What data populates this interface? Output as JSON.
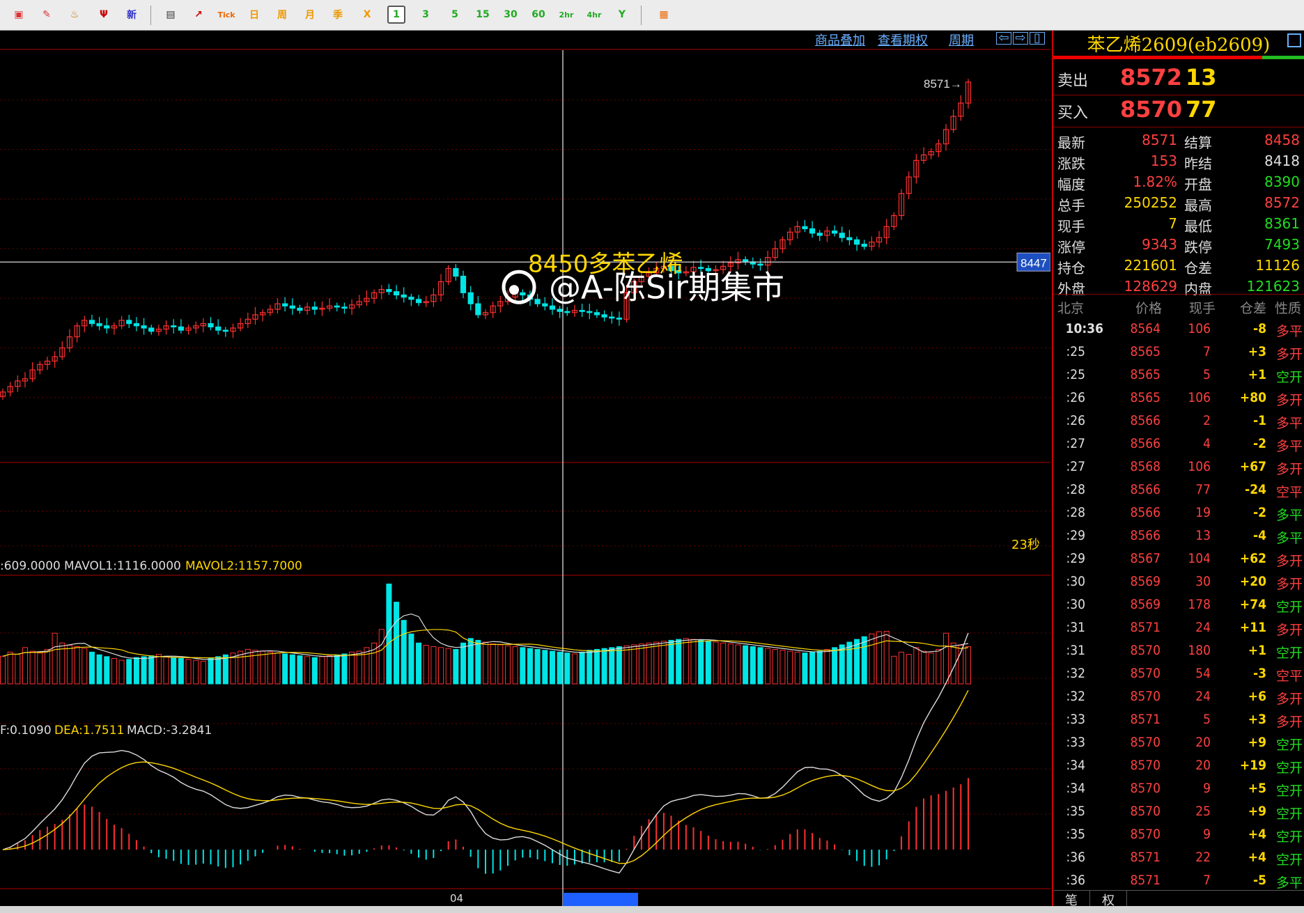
{
  "toolbar": {
    "buttons": [
      {
        "name": "window-icon",
        "glyph": "▣",
        "color": "#d33"
      },
      {
        "name": "pencil-icon",
        "glyph": "✎",
        "color": "#d33"
      },
      {
        "name": "bell-icon",
        "glyph": "♨",
        "color": "#c60"
      },
      {
        "name": "filter-icon",
        "glyph": "Ψ",
        "color": "#c00"
      },
      {
        "name": "new-icon",
        "glyph": "新",
        "color": "#33c"
      },
      {
        "name": "table-icon",
        "glyph": "▤",
        "color": "#333"
      },
      {
        "name": "chart-icon",
        "glyph": "↗",
        "color": "#c00"
      },
      {
        "name": "tick-button",
        "glyph": "Tick",
        "color": "#e60"
      },
      {
        "name": "day-button",
        "glyph": "日",
        "color": "#e90"
      },
      {
        "name": "week-button",
        "glyph": "周",
        "color": "#e90"
      },
      {
        "name": "month-button",
        "glyph": "月",
        "color": "#e90"
      },
      {
        "name": "season-button",
        "glyph": "季",
        "color": "#e90"
      },
      {
        "name": "year-button",
        "glyph": "X",
        "color": "#e90"
      },
      {
        "name": "1min-button",
        "glyph": "1",
        "color": "#2a2"
      },
      {
        "name": "3min-button",
        "glyph": "3",
        "color": "#2a2"
      },
      {
        "name": "5min-button",
        "glyph": "5",
        "color": "#2a2"
      },
      {
        "name": "15min-button",
        "glyph": "15",
        "color": "#2a2"
      },
      {
        "name": "30min-button",
        "glyph": "30",
        "color": "#2a2"
      },
      {
        "name": "60min-button",
        "glyph": "60",
        "color": "#2a2"
      },
      {
        "name": "2h-button",
        "glyph": "2hr",
        "color": "#2a2"
      },
      {
        "name": "4h-button",
        "glyph": "4hr",
        "color": "#2a2"
      },
      {
        "name": "y-button",
        "glyph": "Y",
        "color": "#2a2"
      },
      {
        "name": "calculator-icon",
        "glyph": "▦",
        "color": "#e60"
      }
    ]
  },
  "chart_links": {
    "overlay": "商品叠加",
    "options": "查看期权",
    "period": "周期"
  },
  "main_chart": {
    "last_price_label": "8571",
    "crosshair_price": "8447",
    "countdown": "23秒",
    "annotation": "8450多苯乙烯",
    "watermark": "@A-陈Sir期集市",
    "x_tick": "04"
  },
  "volume_panel": {
    "vol_label": ":609.0000",
    "mavol1": "MAVOL1:1116.0000",
    "mavol2": "MAVOL2:1157.7000"
  },
  "macd_panel": {
    "dif": "F:0.1090",
    "dea": "DEA:1.7511",
    "macd": "MACD:-3.2841"
  },
  "sidebar": {
    "title": "苯乙烯2609(eb2609)",
    "sell": {
      "label": "卖出",
      "price": "8572",
      "volume": "13"
    },
    "buy": {
      "label": "买入",
      "price": "8570",
      "volume": "77"
    },
    "quotes": [
      {
        "l1": "最新",
        "v1": "8571",
        "c1": "#ff4040",
        "l2": "结算",
        "v2": "8458",
        "c2": "#ff4040"
      },
      {
        "l1": "涨跌",
        "v1": "153",
        "c1": "#ff4040",
        "l2": "昨结",
        "v2": "8418",
        "c2": "#e0e0e0"
      },
      {
        "l1": "幅度",
        "v1": "1.82%",
        "c1": "#ff4040",
        "l2": "开盘",
        "v2": "8390",
        "c2": "#22dd22"
      },
      {
        "l1": "总手",
        "v1": "250252",
        "c1": "#ffd700",
        "l2": "最高",
        "v2": "8572",
        "c2": "#ff4040"
      },
      {
        "l1": "现手",
        "v1": "7",
        "c1": "#ffd700",
        "l2": "最低",
        "v2": "8361",
        "c2": "#22dd22"
      },
      {
        "l1": "涨停",
        "v1": "9343",
        "c1": "#ff4040",
        "l2": "跌停",
        "v2": "7493",
        "c2": "#22dd22"
      },
      {
        "l1": "持仓",
        "v1": "221601",
        "c1": "#ffd700",
        "l2": "仓差",
        "v2": "11126",
        "c2": "#ffd700"
      },
      {
        "l1": "外盘",
        "v1": "128629",
        "c1": "#ff4040",
        "l2": "内盘",
        "v2": "121623",
        "c2": "#22dd22"
      }
    ],
    "tick_headers": {
      "time": "北京",
      "price": "价格",
      "vol": "现手",
      "oi": "仓差",
      "nature": "性质"
    },
    "ticks": [
      {
        "t": "10:36",
        "p": "8564",
        "v": "106",
        "o": "-8",
        "n": "多平",
        "nc": "#ff4040",
        "first": true
      },
      {
        "t": ":25",
        "p": "8565",
        "v": "7",
        "o": "+3",
        "n": "多开",
        "nc": "#ff4040"
      },
      {
        "t": ":25",
        "p": "8565",
        "v": "5",
        "o": "+1",
        "n": "空开",
        "nc": "#22dd22"
      },
      {
        "t": ":26",
        "p": "8565",
        "v": "106",
        "o": "+80",
        "n": "多开",
        "nc": "#ff4040"
      },
      {
        "t": ":26",
        "p": "8566",
        "v": "2",
        "o": "-1",
        "n": "多平",
        "nc": "#ff4040"
      },
      {
        "t": ":27",
        "p": "8566",
        "v": "4",
        "o": "-2",
        "n": "多平",
        "nc": "#ff4040"
      },
      {
        "t": ":27",
        "p": "8568",
        "v": "106",
        "o": "+67",
        "n": "多开",
        "nc": "#ff4040"
      },
      {
        "t": ":28",
        "p": "8566",
        "v": "77",
        "o": "-24",
        "n": "空平",
        "nc": "#ff4040"
      },
      {
        "t": ":28",
        "p": "8566",
        "v": "19",
        "o": "-2",
        "n": "多平",
        "nc": "#22dd22"
      },
      {
        "t": ":29",
        "p": "8566",
        "v": "13",
        "o": "-4",
        "n": "多平",
        "nc": "#22dd22"
      },
      {
        "t": ":29",
        "p": "8567",
        "v": "104",
        "o": "+62",
        "n": "多开",
        "nc": "#ff4040"
      },
      {
        "t": ":30",
        "p": "8569",
        "v": "30",
        "o": "+20",
        "n": "多开",
        "nc": "#ff4040"
      },
      {
        "t": ":30",
        "p": "8569",
        "v": "178",
        "o": "+74",
        "n": "空开",
        "nc": "#22dd22"
      },
      {
        "t": ":31",
        "p": "8571",
        "v": "24",
        "o": "+11",
        "n": "多开",
        "nc": "#ff4040"
      },
      {
        "t": ":31",
        "p": "8570",
        "v": "180",
        "o": "+1",
        "n": "空开",
        "nc": "#22dd22"
      },
      {
        "t": ":32",
        "p": "8570",
        "v": "54",
        "o": "-3",
        "n": "空平",
        "nc": "#ff4040"
      },
      {
        "t": ":32",
        "p": "8570",
        "v": "24",
        "o": "+6",
        "n": "多开",
        "nc": "#ff4040"
      },
      {
        "t": ":33",
        "p": "8571",
        "v": "5",
        "o": "+3",
        "n": "多开",
        "nc": "#ff4040"
      },
      {
        "t": ":33",
        "p": "8570",
        "v": "20",
        "o": "+9",
        "n": "空开",
        "nc": "#22dd22"
      },
      {
        "t": ":34",
        "p": "8570",
        "v": "20",
        "o": "+19",
        "n": "空开",
        "nc": "#22dd22"
      },
      {
        "t": ":34",
        "p": "8570",
        "v": "9",
        "o": "+5",
        "n": "空开",
        "nc": "#22dd22"
      },
      {
        "t": ":35",
        "p": "8570",
        "v": "25",
        "o": "+9",
        "n": "空开",
        "nc": "#22dd22"
      },
      {
        "t": ":35",
        "p": "8570",
        "v": "9",
        "o": "+4",
        "n": "空开",
        "nc": "#22dd22"
      },
      {
        "t": ":36",
        "p": "8571",
        "v": "22",
        "o": "+4",
        "n": "空开",
        "nc": "#22dd22"
      },
      {
        "t": ":36",
        "p": "8571",
        "v": "7",
        "o": "-5",
        "n": "多平",
        "nc": "#22dd22"
      }
    ],
    "bottom_tabs": [
      "笔",
      "权"
    ]
  },
  "chart_data": {
    "type": "candlestick",
    "price_series_close": [
      8290,
      8295,
      8300,
      8302,
      8310,
      8315,
      8318,
      8322,
      8330,
      8340,
      8350,
      8355,
      8352,
      8350,
      8348,
      8350,
      8355,
      8352,
      8350,
      8348,
      8345,
      8347,
      8350,
      8349,
      8346,
      8348,
      8350,
      8352,
      8349,
      8346,
      8345,
      8348,
      8352,
      8356,
      8360,
      8362,
      8365,
      8370,
      8368,
      8366,
      8364,
      8367,
      8365,
      8366,
      8368,
      8367,
      8366,
      8369,
      8372,
      8375,
      8380,
      8383,
      8381,
      8378,
      8376,
      8374,
      8371,
      8372,
      8378,
      8390,
      8402,
      8395,
      8380,
      8370,
      8360,
      8362,
      8368,
      8372,
      8376,
      8380,
      8378,
      8374,
      8370,
      8368,
      8365,
      8363,
      8362,
      8364,
      8363,
      8362,
      8360,
      8358,
      8357,
      8356,
      8380,
      8390,
      8395,
      8398,
      8402,
      8404,
      8400,
      8398,
      8399,
      8403,
      8402,
      8400,
      8401,
      8404,
      8407,
      8410,
      8408,
      8406,
      8405,
      8412,
      8420,
      8428,
      8435,
      8440,
      8438,
      8434,
      8432,
      8436,
      8434,
      8430,
      8428,
      8424,
      8422,
      8426,
      8430,
      8440,
      8450,
      8470,
      8485,
      8500,
      8505,
      8508,
      8515,
      8528,
      8540,
      8552,
      8571
    ],
    "price_range": [
      8240,
      8600
    ],
    "last_price": 8571,
    "crosshair_price": 8447,
    "volume_series": [
      609,
      700,
      650,
      800,
      720,
      680,
      760,
      1116,
      900,
      850,
      820,
      780,
      700,
      640,
      600,
      560,
      520,
      540,
      580,
      600,
      620,
      650,
      600,
      580,
      560,
      540,
      520,
      500,
      560,
      600,
      640,
      680,
      720,
      760,
      740,
      720,
      700,
      680,
      660,
      640,
      620,
      600,
      580,
      600,
      620,
      640,
      660,
      700,
      720,
      800,
      900,
      1200,
      2200,
      1800,
      1400,
      1100,
      900,
      850,
      820,
      800,
      780,
      760,
      900,
      1000,
      960,
      920,
      880,
      860,
      840,
      820,
      800,
      780,
      760,
      740,
      720,
      700,
      680,
      660,
      700,
      740,
      760,
      780,
      800,
      820,
      840,
      860,
      880,
      900,
      920,
      940,
      960,
      980,
      1000,
      980,
      960,
      940,
      920,
      900,
      880,
      860,
      840,
      820,
      800,
      780,
      760,
      740,
      720,
      700,
      680,
      700,
      720,
      760,
      800,
      860,
      920,
      980,
      1040,
      1100,
      1150,
      1157
    ],
    "mavol": {
      "MAVOL1": 1116.0,
      "MAVOL2": 1157.7
    },
    "macd": {
      "DIF": 0.109,
      "DEA": 1.7511,
      "MACD": -3.2841
    }
  }
}
